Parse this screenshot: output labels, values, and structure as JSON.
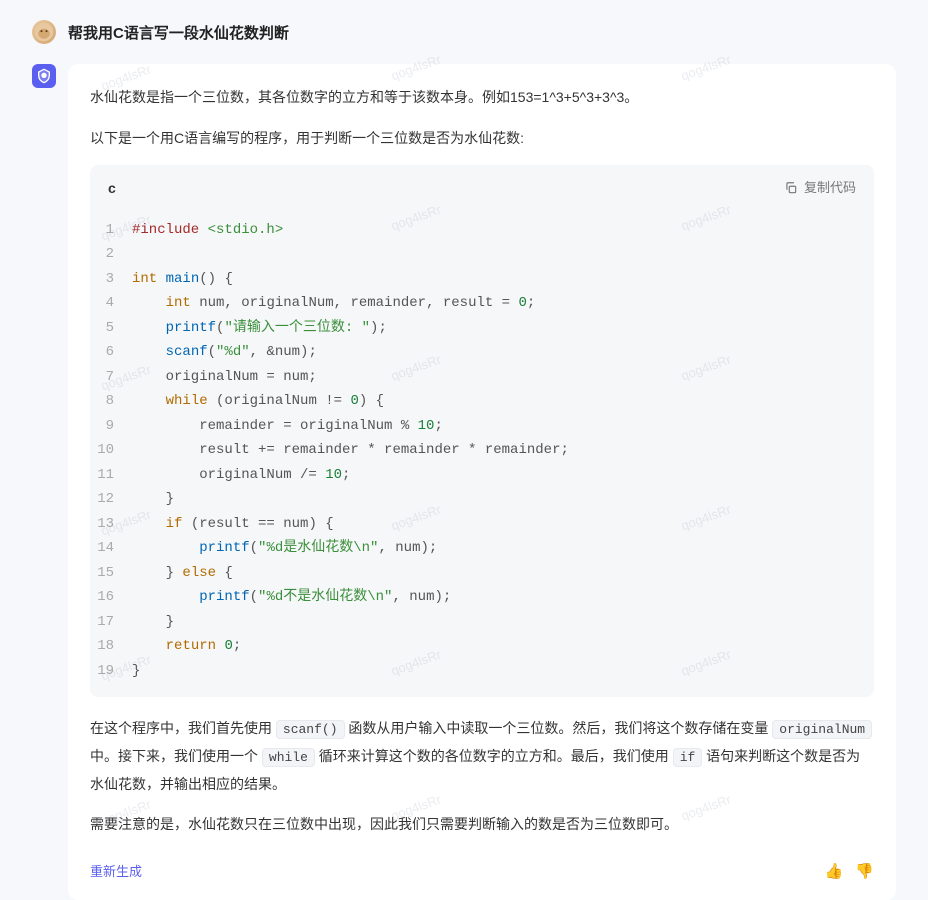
{
  "watermark": "qog4lsRr",
  "user": {
    "prompt": "帮我用C语言写一段水仙花数判断"
  },
  "assistant": {
    "paragraphs": {
      "p1": "水仙花数是指一个三位数，其各位数字的立方和等于该数本身。例如153=1^3+5^3+3^3。",
      "p2": "以下是一个用C语言编写的程序，用于判断一个三位数是否为水仙花数:",
      "p3_pre": "在这个程序中，我们首先使用 ",
      "p3_code1": "scanf()",
      "p3_mid1": " 函数从用户输入中读取一个三位数。然后，我们将这个数存储在变量 ",
      "p3_code2": "originalNum",
      "p3_mid2": " 中。接下来，我们使用一个 ",
      "p3_code3": "while",
      "p3_mid3": " 循环来计算这个数的各位数字的立方和。最后，我们使用 ",
      "p3_code4": "if",
      "p3_post": " 语句来判断这个数是否为水仙花数，并输出相应的结果。",
      "p4": "需要注意的是，水仙花数只在三位数中出现，因此我们只需要判断输入的数是否为三位数即可。"
    },
    "code": {
      "language": "c",
      "copy_label": "复制代码",
      "lines": {
        "l1_pre": "#include",
        "l1_inc": " <stdio.h>",
        "l3_kw": "int",
        "l3_fn": " main",
        "l3_rest": "() {",
        "l4_indent": "    ",
        "l4_kw": "int",
        "l4_rest": " num, originalNum, remainder, result = ",
        "l4_num": "0",
        "l4_semi": ";",
        "l5_indent": "    ",
        "l5_fn": "printf",
        "l5_open": "(",
        "l5_str": "\"请输入一个三位数: \"",
        "l5_close": ");",
        "l6_indent": "    ",
        "l6_fn": "scanf",
        "l6_open": "(",
        "l6_str": "\"%d\"",
        "l6_rest": ", &num);",
        "l7": "    originalNum = num;",
        "l8_indent": "    ",
        "l8_kw": "while",
        "l8_rest": " (originalNum != ",
        "l8_num": "0",
        "l8_close": ") {",
        "l9_indent": "        remainder = originalNum % ",
        "l9_num": "10",
        "l9_semi": ";",
        "l10": "        result += remainder * remainder * remainder;",
        "l11_indent": "        originalNum /= ",
        "l11_num": "10",
        "l11_semi": ";",
        "l12": "    }",
        "l13_indent": "    ",
        "l13_kw": "if",
        "l13_rest": " (result == num) {",
        "l14_indent": "        ",
        "l14_fn": "printf",
        "l14_open": "(",
        "l14_str": "\"%d是水仙花数\\n\"",
        "l14_rest": ", num);",
        "l15_indent": "    } ",
        "l15_kw": "else",
        "l15_rest": " {",
        "l16_indent": "        ",
        "l16_fn": "printf",
        "l16_open": "(",
        "l16_str": "\"%d不是水仙花数\\n\"",
        "l16_rest": ", num);",
        "l17": "    }",
        "l18_indent": "    ",
        "l18_kw": "return",
        "l18_rest": " ",
        "l18_num": "0",
        "l18_semi": ";",
        "l19": "}"
      }
    },
    "regenerate": "重新生成"
  }
}
